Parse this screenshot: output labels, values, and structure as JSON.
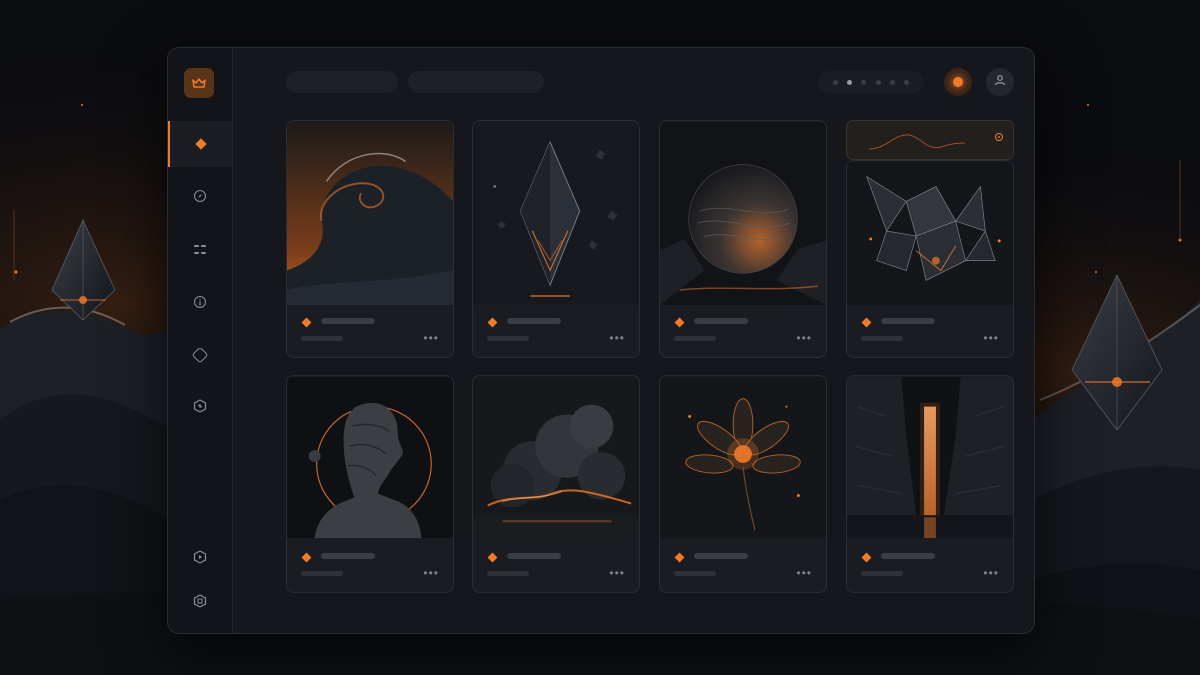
{
  "sidebar": {
    "logo_icon": "crown-icon",
    "nav": [
      {
        "icon": "diamond-icon",
        "active": true
      },
      {
        "icon": "compass-icon",
        "active": false
      },
      {
        "icon": "grid-icon",
        "active": false
      },
      {
        "icon": "info-icon",
        "active": false
      },
      {
        "icon": "hexagon-icon",
        "active": false
      },
      {
        "icon": "cube-icon",
        "active": false
      }
    ],
    "bottom_nav": [
      {
        "icon": "play-icon"
      },
      {
        "icon": "settings-icon"
      }
    ]
  },
  "topbar": {
    "pagination_dots": 6,
    "active_dot": 2,
    "record_icon": "record-icon",
    "user_icon": "user-icon"
  },
  "widget": {
    "icon": "target-icon",
    "chart": "waveform"
  },
  "gallery": [
    {
      "art": "ocean-wave"
    },
    {
      "art": "glass-diamond"
    },
    {
      "art": "dark-sphere"
    },
    {
      "art": "shattered-crystal"
    },
    {
      "art": "stone-bust-halo"
    },
    {
      "art": "fiery-cloud"
    },
    {
      "art": "glowing-flower"
    },
    {
      "art": "light-pillar-canyon"
    }
  ],
  "card_more_label": "•••",
  "colors": {
    "accent": "#f07a2a",
    "window": "#15171c",
    "card": "#1a1c21",
    "background": "#0b0c10"
  }
}
